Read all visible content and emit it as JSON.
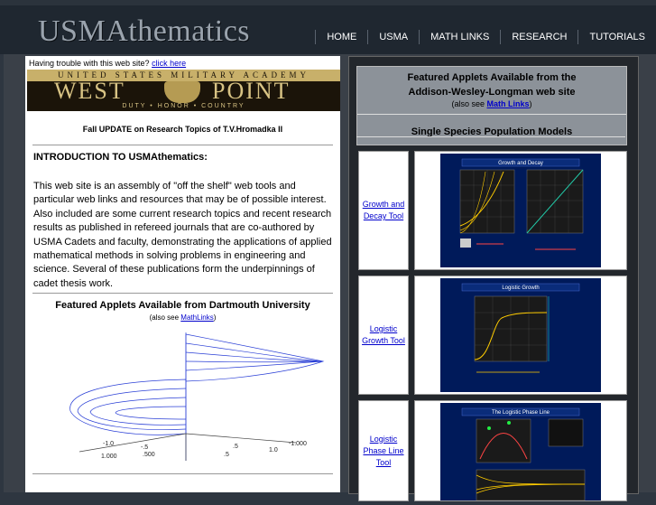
{
  "header": {
    "logo": "USMAthematics",
    "nav": [
      "HOME",
      "USMA",
      "MATH LINKS",
      "RESEARCH",
      "TUTORIALS"
    ]
  },
  "left": {
    "trouble_text": "Having trouble with this web site?",
    "trouble_link": "click here",
    "banner": {
      "top": "UNITED STATES MILITARY ACADEMY",
      "word1": "WEST",
      "word2": "POINT",
      "motto": "DUTY • HONOR • COUNTRY"
    },
    "update": "Fall UPDATE on Research Topics of T.V.Hromadka II",
    "intro_heading": "INTRODUCTION TO USMAthematics:",
    "intro_body": "This web site is an assembly of \"off the shelf\" web tools and particular web links and resources that may be of possible interest. Also included are some current research topics and recent research results as published in refereed journals that are co-authored by USMA Cadets and faculty, demonstrating the applications of applied mathematical methods in solving problems in engineering and science. Several of these publications form the underpinnings of cadet thesis work.",
    "dartmouth_heading": "Featured Applets Available from Dartmouth University",
    "dartmouth_sub_pre": "(also see",
    "dartmouth_sub_link": "MathLinks",
    "dartmouth_sub_post": ")",
    "plot_ticks": [
      "-1.0",
      "-.5",
      ".5",
      "1.0",
      "1.000",
      ".500",
      "-1.000",
      ".5"
    ]
  },
  "right": {
    "featured_line1": "Featured Applets Available from the",
    "featured_line2": "Addison-Wesley-Longman web site",
    "featured_sub_pre": "(also see",
    "featured_sub_link": "Math Links",
    "featured_sub_post": ")",
    "single_species": "Single Species Population Models",
    "rows": [
      {
        "label": "Growth and Decay Tool",
        "applet_title": "Growth and Decay"
      },
      {
        "label": "Logistic Growth Tool",
        "applet_title": "Logistic Growth"
      },
      {
        "label": "Logistic Phase Line Tool",
        "applet_title": "The Logistic Phase Line"
      }
    ]
  }
}
